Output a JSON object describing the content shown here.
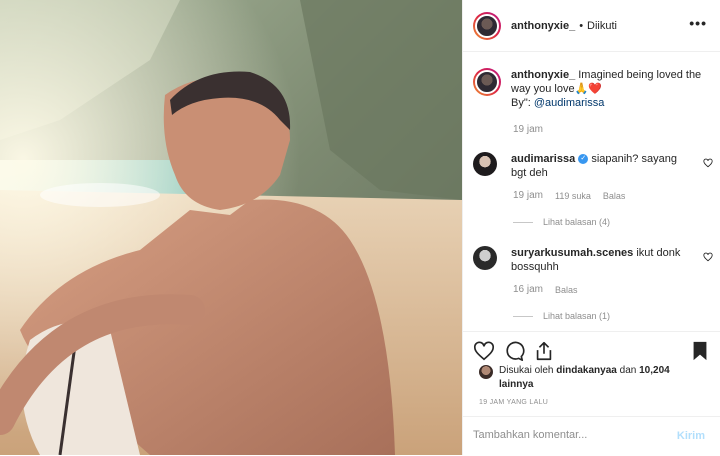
{
  "post": {
    "image_alt": "photo",
    "author": "anthonyxie_",
    "separator": "•",
    "follow_state": "Diikuti",
    "more_icon": "more-horizontal-icon",
    "caption": {
      "username": "anthonyxie_",
      "text": "Imagined being loved the way you love🙏❤️",
      "by_prefix": "By\": ",
      "mention": "@audimarissa",
      "time": "19 jam"
    },
    "comments": [
      {
        "username": "audimarissa",
        "verified": true,
        "text": "siapanih? sayang bgt deh",
        "time": "19 jam",
        "likes": "119 suka",
        "reply": "Balas",
        "view_replies": "Lihat balasan (4)"
      },
      {
        "username": "suryarkusumah.scenes",
        "verified": false,
        "text": "ikut donk bossquhh",
        "time": "16 jam",
        "likes": "",
        "reply": "Balas",
        "view_replies": "Lihat balasan (1)"
      }
    ],
    "likes_text_prefix": "Disukai oleh ",
    "likes_user": "dindakanyaa",
    "likes_text_mid": " dan ",
    "likes_count": "10,204 lainnya",
    "ago": "19 JAM YANG LALU",
    "comment_placeholder": "Tambahkan komentar...",
    "post_button": "Kirim",
    "colors": {
      "link": "#00376b",
      "muted": "#8e8e8e",
      "post_button": "#b2dffc",
      "verified": "#3897f0"
    }
  }
}
